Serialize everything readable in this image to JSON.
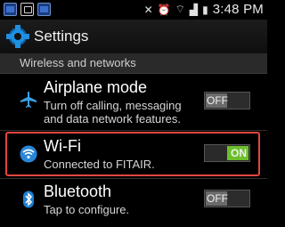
{
  "status_bar": {
    "time": "3:48 PM",
    "icons": [
      "image-icon",
      "notification-icon",
      "image-icon",
      "mute-icon",
      "alarm-icon",
      "wifi-signal-icon",
      "cell-signal-icon",
      "battery-icon"
    ]
  },
  "action_bar": {
    "title": "Settings",
    "icon": "settings-gear-icon"
  },
  "section": {
    "label": "Wireless and networks"
  },
  "rows": [
    {
      "title": "Airplane mode",
      "subtitle_line1": "Turn off calling, messaging",
      "subtitle_line2": "and data network features.",
      "toggle": "OFF",
      "icon": "airplane-icon"
    },
    {
      "title": "Wi-Fi",
      "subtitle": "Connected to FITAIR.",
      "toggle": "ON",
      "icon": "wifi-icon",
      "highlighted": true
    },
    {
      "title": "Bluetooth",
      "subtitle": "Tap to configure.",
      "toggle": "OFF",
      "icon": "bluetooth-icon"
    }
  ],
  "colors": {
    "accent_blue": "#1f8fe0",
    "toggle_on": "#6cbf2a",
    "highlight_red": "#e2463f",
    "background": "#000000"
  }
}
